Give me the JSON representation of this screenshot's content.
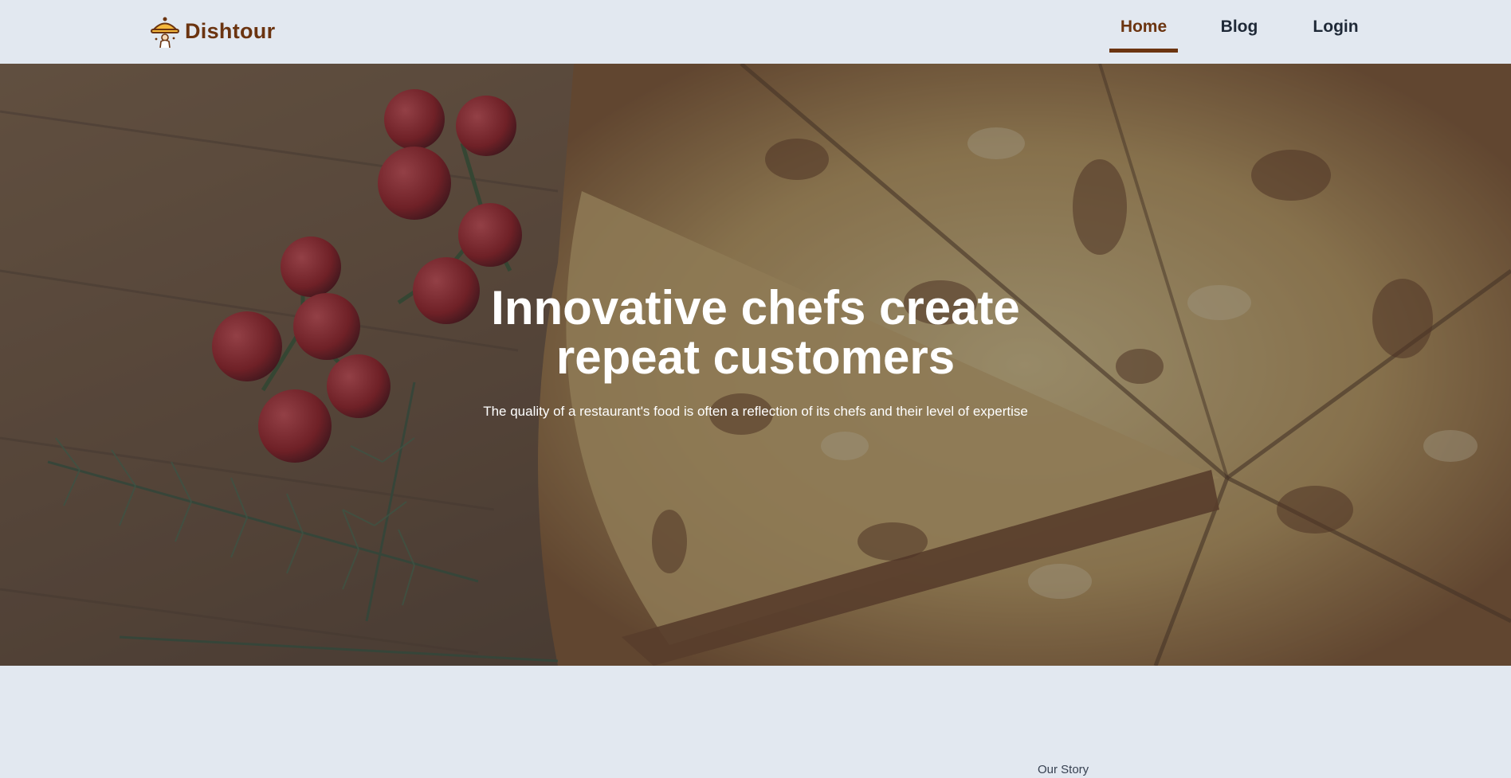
{
  "brand": {
    "name": "Dishtour",
    "icon": "chef-cloche-icon",
    "color": "#6b3410",
    "icon_color": "#f5b83d"
  },
  "nav": {
    "items": [
      {
        "label": "Home",
        "active": true
      },
      {
        "label": "Blog",
        "active": false
      },
      {
        "label": "Login",
        "active": false
      }
    ],
    "active_color": "#6b3410"
  },
  "hero": {
    "title": "Innovative chefs create repeat customers",
    "subtitle": "The quality of a restaurant's food is often a reflection of its chefs and their level of expertise",
    "background_image": "pizza-on-wooden-board-photo"
  },
  "section": {
    "label": "Our Story"
  },
  "colors": {
    "page_background": "#e2e8f0",
    "text_dark": "#1f2937"
  }
}
